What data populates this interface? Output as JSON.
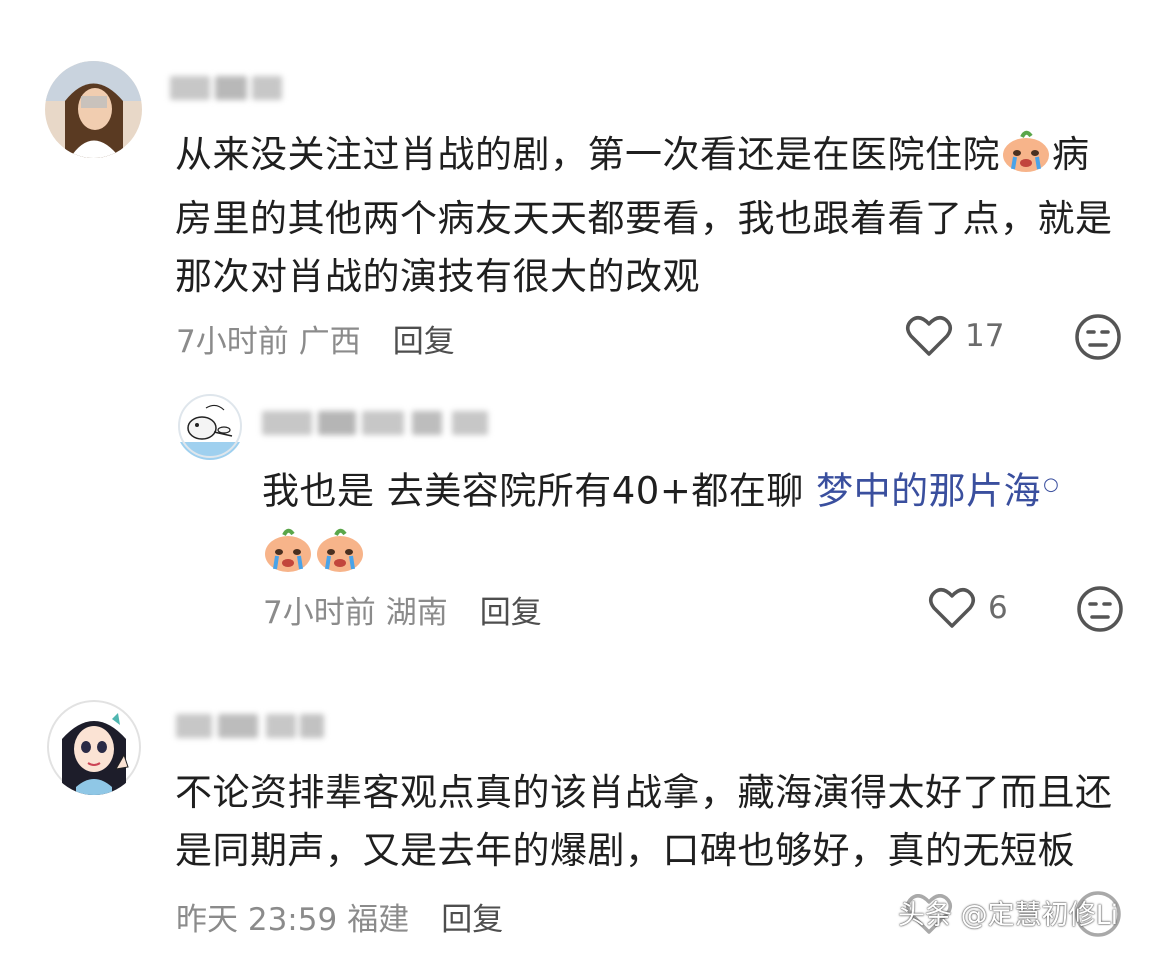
{
  "comments": [
    {
      "lines": [
        "从来没关注过肖战的剧，第一次看还是在医院住院",
        "病",
        "房里的其他两个病友天天都要看，我也跟着看了点，就是",
        "那次对肖战的演技有很大的改观"
      ],
      "emoji": "crying-peach-emoji",
      "time": "7小时前",
      "location": "广西",
      "reply_label": "回复",
      "likes": "17"
    },
    {
      "text_before_link": "我也是 去美容院所有40+都在聊 ",
      "link_text": "梦中的那片海",
      "emojis": [
        "crying-peach-emoji",
        "crying-peach-emoji"
      ],
      "time": "7小时前",
      "location": "湖南",
      "reply_label": "回复",
      "likes": "6"
    },
    {
      "lines": [
        "不论资排辈客观点真的该肖战拿，藏海演得太好了而且还",
        "是同期声，又是去年的爆剧，口碑也够好，真的无短板"
      ],
      "time": "昨天 23:59",
      "location": "福建",
      "reply_label": "回复"
    }
  ],
  "watermark": "头条 @定慧初修Li",
  "colors": {
    "text": "#1f1f1f",
    "meta": "#8b8b8b",
    "link": "#3a4f9e",
    "icon": "#555555"
  }
}
